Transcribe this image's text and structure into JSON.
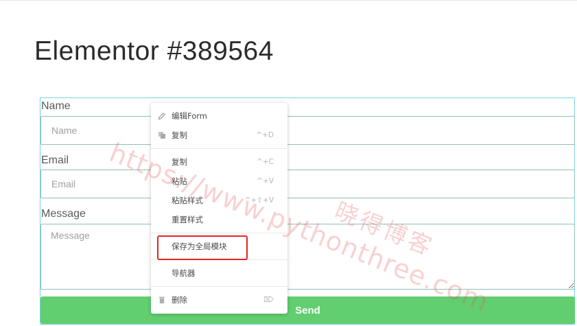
{
  "page": {
    "title": "Elementor #389564"
  },
  "form": {
    "fields": [
      {
        "label": "Name",
        "placeholder": "Name"
      },
      {
        "label": "Email",
        "placeholder": "Email"
      },
      {
        "label": "Message",
        "placeholder": "Message"
      }
    ],
    "submit_label": "Send"
  },
  "context_menu": {
    "groups": [
      [
        {
          "label": "编辑Form",
          "shortcut": "",
          "icon": "pencil-icon"
        },
        {
          "label": "复制",
          "shortcut": "^+D",
          "icon": "duplicate-icon"
        }
      ],
      [
        {
          "label": "复制",
          "shortcut": "^+C",
          "icon": ""
        },
        {
          "label": "粘贴",
          "shortcut": "^+V",
          "icon": ""
        },
        {
          "label": "粘贴样式",
          "shortcut": "^+⇧+V",
          "icon": ""
        },
        {
          "label": "重置样式",
          "shortcut": "",
          "icon": ""
        }
      ],
      [
        {
          "label": "保存为全局模块",
          "shortcut": "",
          "icon": ""
        }
      ],
      [
        {
          "label": "导航器",
          "shortcut": "",
          "icon": ""
        }
      ],
      [
        {
          "label": "删除",
          "shortcut": "⌦",
          "icon": "trash-icon"
        }
      ]
    ],
    "highlighted_item": "保存为全局模块"
  },
  "watermark": {
    "url": "https://www.pythonthree.com",
    "name": "晓得博客"
  },
  "colors": {
    "send_button": "#61ce70",
    "highlight_border": "#e02626",
    "form_outline": "#7fd0e6",
    "input_border": "#8fbfb8",
    "watermark": "#e65a5a"
  }
}
